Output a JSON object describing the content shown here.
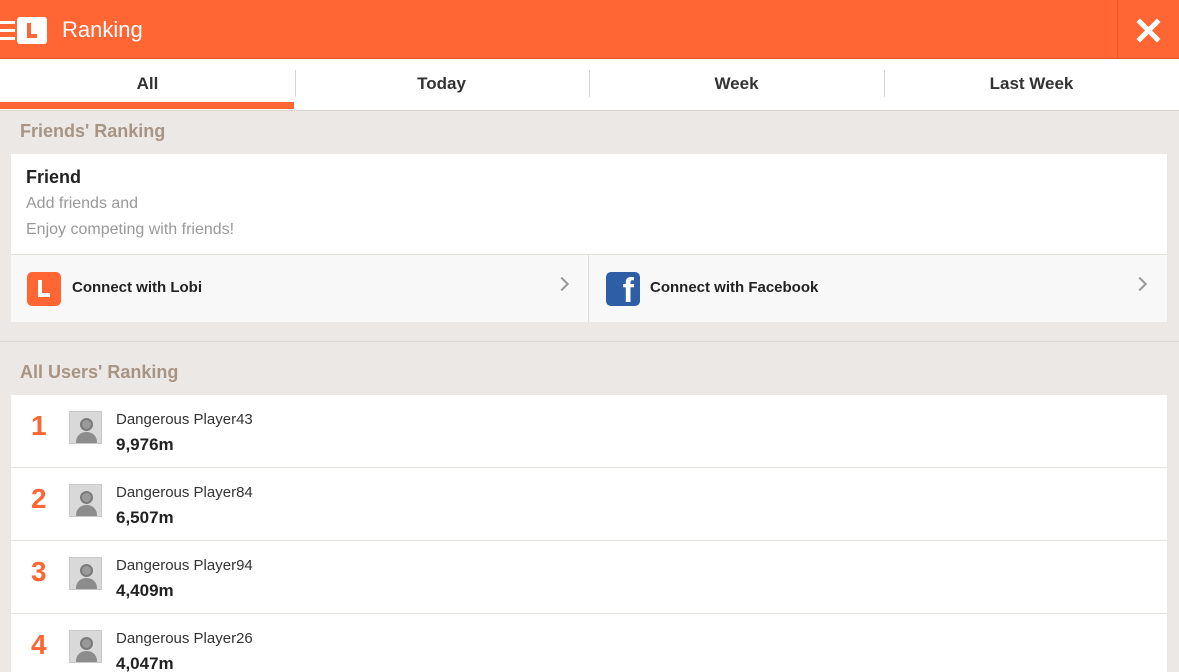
{
  "header": {
    "title": "Ranking"
  },
  "tabs": [
    {
      "label": "All",
      "active": true
    },
    {
      "label": "Today",
      "active": false
    },
    {
      "label": "Week",
      "active": false
    },
    {
      "label": "Last Week",
      "active": false
    }
  ],
  "friends_section": {
    "title": "Friends' Ranking",
    "card_title": "Friend",
    "desc_line1": "Add friends and",
    "desc_line2": "Enjoy competing with friends!",
    "connect_lobi": "Connect with Lobi",
    "connect_facebook": "Connect with Facebook"
  },
  "all_users_section": {
    "title": "All Users' Ranking",
    "rows": [
      {
        "rank": "1",
        "name": "Dangerous Player43",
        "score": "9,976m"
      },
      {
        "rank": "2",
        "name": "Dangerous Player84",
        "score": "6,507m"
      },
      {
        "rank": "3",
        "name": "Dangerous Player94",
        "score": "4,409m"
      },
      {
        "rank": "4",
        "name": "Dangerous Player26",
        "score": "4,047m"
      }
    ]
  },
  "colors": {
    "accent": "#ff6633",
    "facebook": "#2d5ea6",
    "section_title": "#a89482",
    "background": "#ece8e5"
  },
  "icons": {
    "menu": "menu-icon",
    "logo": "lobi-logo-icon",
    "close": "close-icon",
    "facebook": "facebook-icon",
    "chevron": "chevron-right-icon",
    "avatar": "avatar-icon"
  }
}
